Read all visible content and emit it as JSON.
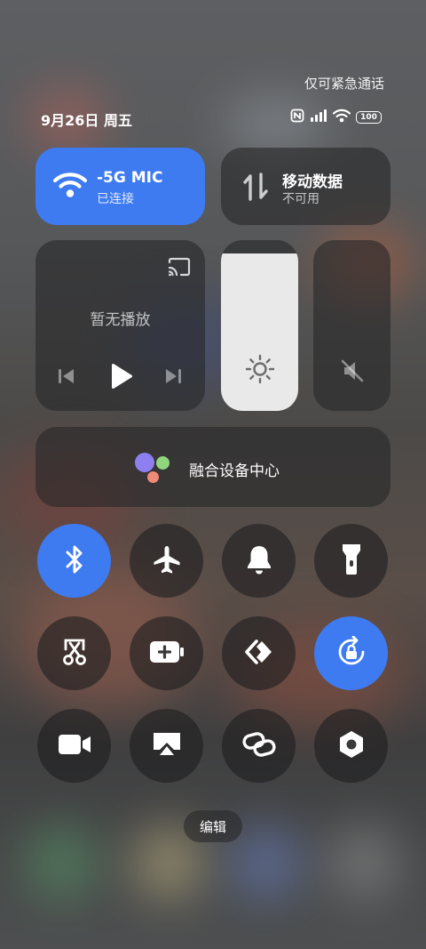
{
  "status_bar": {
    "emergency_text": "仅可紧急通话",
    "date_text": "9月26日 周五",
    "battery_level": "100",
    "icons": [
      "nfc-icon",
      "signal-icon",
      "wifi-icon",
      "battery-icon"
    ]
  },
  "wifi_tile": {
    "title": "-5G      MIC",
    "subtitle": "已连接",
    "icon": "wifi-icon",
    "active": true,
    "accent": "#3e7bf1"
  },
  "mobile_data_tile": {
    "title": "移动数据",
    "subtitle": "不可用",
    "icon": "mobile-data-arrows-icon",
    "active": false
  },
  "media_tile": {
    "status": "暂无播放",
    "icons": [
      "cast-icon",
      "previous-icon",
      "play-icon",
      "next-icon"
    ]
  },
  "brightness": {
    "level": 0.92,
    "icon": "sun-icon"
  },
  "volume": {
    "level": 0,
    "icon": "mute-icon"
  },
  "device_hub": {
    "label": "融合设备中心",
    "icon": "device-hub-dots-icon"
  },
  "toggles": [
    {
      "name": "bluetooth",
      "icon": "bluetooth-icon",
      "active": true
    },
    {
      "name": "airplane-mode",
      "icon": "airplane-icon",
      "active": false
    },
    {
      "name": "ringer",
      "icon": "bell-icon",
      "active": false
    },
    {
      "name": "flashlight",
      "icon": "flashlight-icon",
      "active": false
    },
    {
      "name": "screenshot",
      "icon": "scissors-icon",
      "active": false
    },
    {
      "name": "battery-saver",
      "icon": "battery-plus-icon",
      "active": false
    },
    {
      "name": "cast-link",
      "icon": "chevron-link-icon",
      "active": false
    },
    {
      "name": "rotation-lock",
      "icon": "rotation-lock-icon",
      "active": true
    },
    {
      "name": "screen-record",
      "icon": "video-camera-icon",
      "active": false
    },
    {
      "name": "screen-share",
      "icon": "airplay-icon",
      "active": false
    },
    {
      "name": "link-share",
      "icon": "chain-link-icon",
      "active": false
    },
    {
      "name": "settings",
      "icon": "hexagon-gear-icon",
      "active": false
    }
  ],
  "edit_button": {
    "label": "编辑"
  }
}
